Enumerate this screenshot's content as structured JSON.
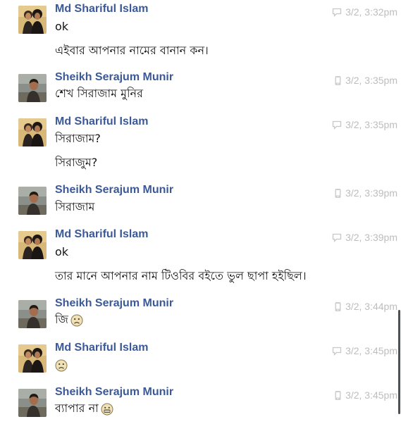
{
  "messages": [
    {
      "sender": "Md Shariful Islam",
      "time": "3/2, 3:32pm",
      "source_icon": "chat-bubble-icon",
      "avatar": "avatar-couple",
      "lines": [
        {
          "text": "ok"
        },
        {
          "text": "এইবার আপনার নামের বানান কন।"
        }
      ]
    },
    {
      "sender": "Sheikh Serajum Munir",
      "time": "3/2, 3:35pm",
      "source_icon": "mobile-phone-icon",
      "avatar": "avatar-man",
      "lines": [
        {
          "text": "শেখ সিরাজাম মুনির"
        }
      ]
    },
    {
      "sender": "Md Shariful Islam",
      "time": "3/2, 3:35pm",
      "source_icon": "chat-bubble-icon",
      "avatar": "avatar-couple",
      "lines": [
        {
          "text": "সিরাজাম?"
        },
        {
          "text": "সিরাজুম?"
        }
      ]
    },
    {
      "sender": "Sheikh Serajum Munir",
      "time": "3/2, 3:39pm",
      "source_icon": "mobile-phone-icon",
      "avatar": "avatar-man",
      "lines": [
        {
          "text": "সিরাজাম"
        }
      ]
    },
    {
      "sender": "Md Shariful Islam",
      "time": "3/2, 3:39pm",
      "source_icon": "chat-bubble-icon",
      "avatar": "avatar-couple",
      "lines": [
        {
          "text": "ok"
        },
        {
          "text": "তার মানে আপনার নাম টিওবির বইতে ভুল ছাপা হইছিল।"
        }
      ]
    },
    {
      "sender": "Sheikh Serajum Munir",
      "time": "3/2, 3:44pm",
      "source_icon": "mobile-phone-icon",
      "avatar": "avatar-man",
      "lines": [
        {
          "text": "জি",
          "emoji": "frown-emoji-icon"
        }
      ]
    },
    {
      "sender": "Md Shariful Islam",
      "time": "3/2, 3:45pm",
      "source_icon": "chat-bubble-icon",
      "avatar": "avatar-couple",
      "lines": [
        {
          "text": "",
          "emoji": "frown-emoji-icon"
        }
      ]
    },
    {
      "sender": "Sheikh Serajum Munir",
      "time": "3/2, 3:45pm",
      "source_icon": "mobile-phone-icon",
      "avatar": "avatar-man",
      "lines": [
        {
          "text": "ব্যাপার না",
          "emoji": "grin-emoji-icon"
        }
      ]
    }
  ],
  "colors": {
    "sender": "#3b5998",
    "timestamp": "#bdbdbd",
    "message_text": "#141414"
  }
}
